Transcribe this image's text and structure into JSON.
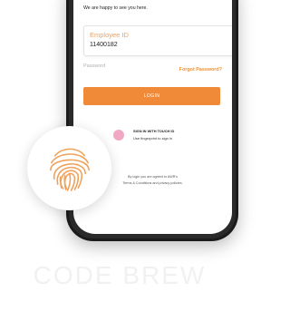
{
  "header": {
    "welcome_text": "We are happy to see you here."
  },
  "employee_field": {
    "label": "Employee ID",
    "value": "11400182"
  },
  "password_field": {
    "label": "Password"
  },
  "forgot_password": "Forgot Password?",
  "login_button": "LOGIN",
  "touch_id": {
    "title": "SIGN IN WITH TOUCH ID",
    "subtitle": "Use fingerprint to sign in"
  },
  "terms": {
    "line1": "By login you are agreed to AWR's",
    "line2": "Terms & Conditions and privacy policies."
  },
  "watermark": "CODE BREW",
  "colors": {
    "accent": "#f08a38",
    "label_orange": "#f0a05c",
    "touch_icon_pink": "#f0a8c4",
    "fingerprint": "#f0a15a"
  },
  "icons": {
    "fingerprint": "fingerprint-icon",
    "touch": "touch-id-icon"
  }
}
